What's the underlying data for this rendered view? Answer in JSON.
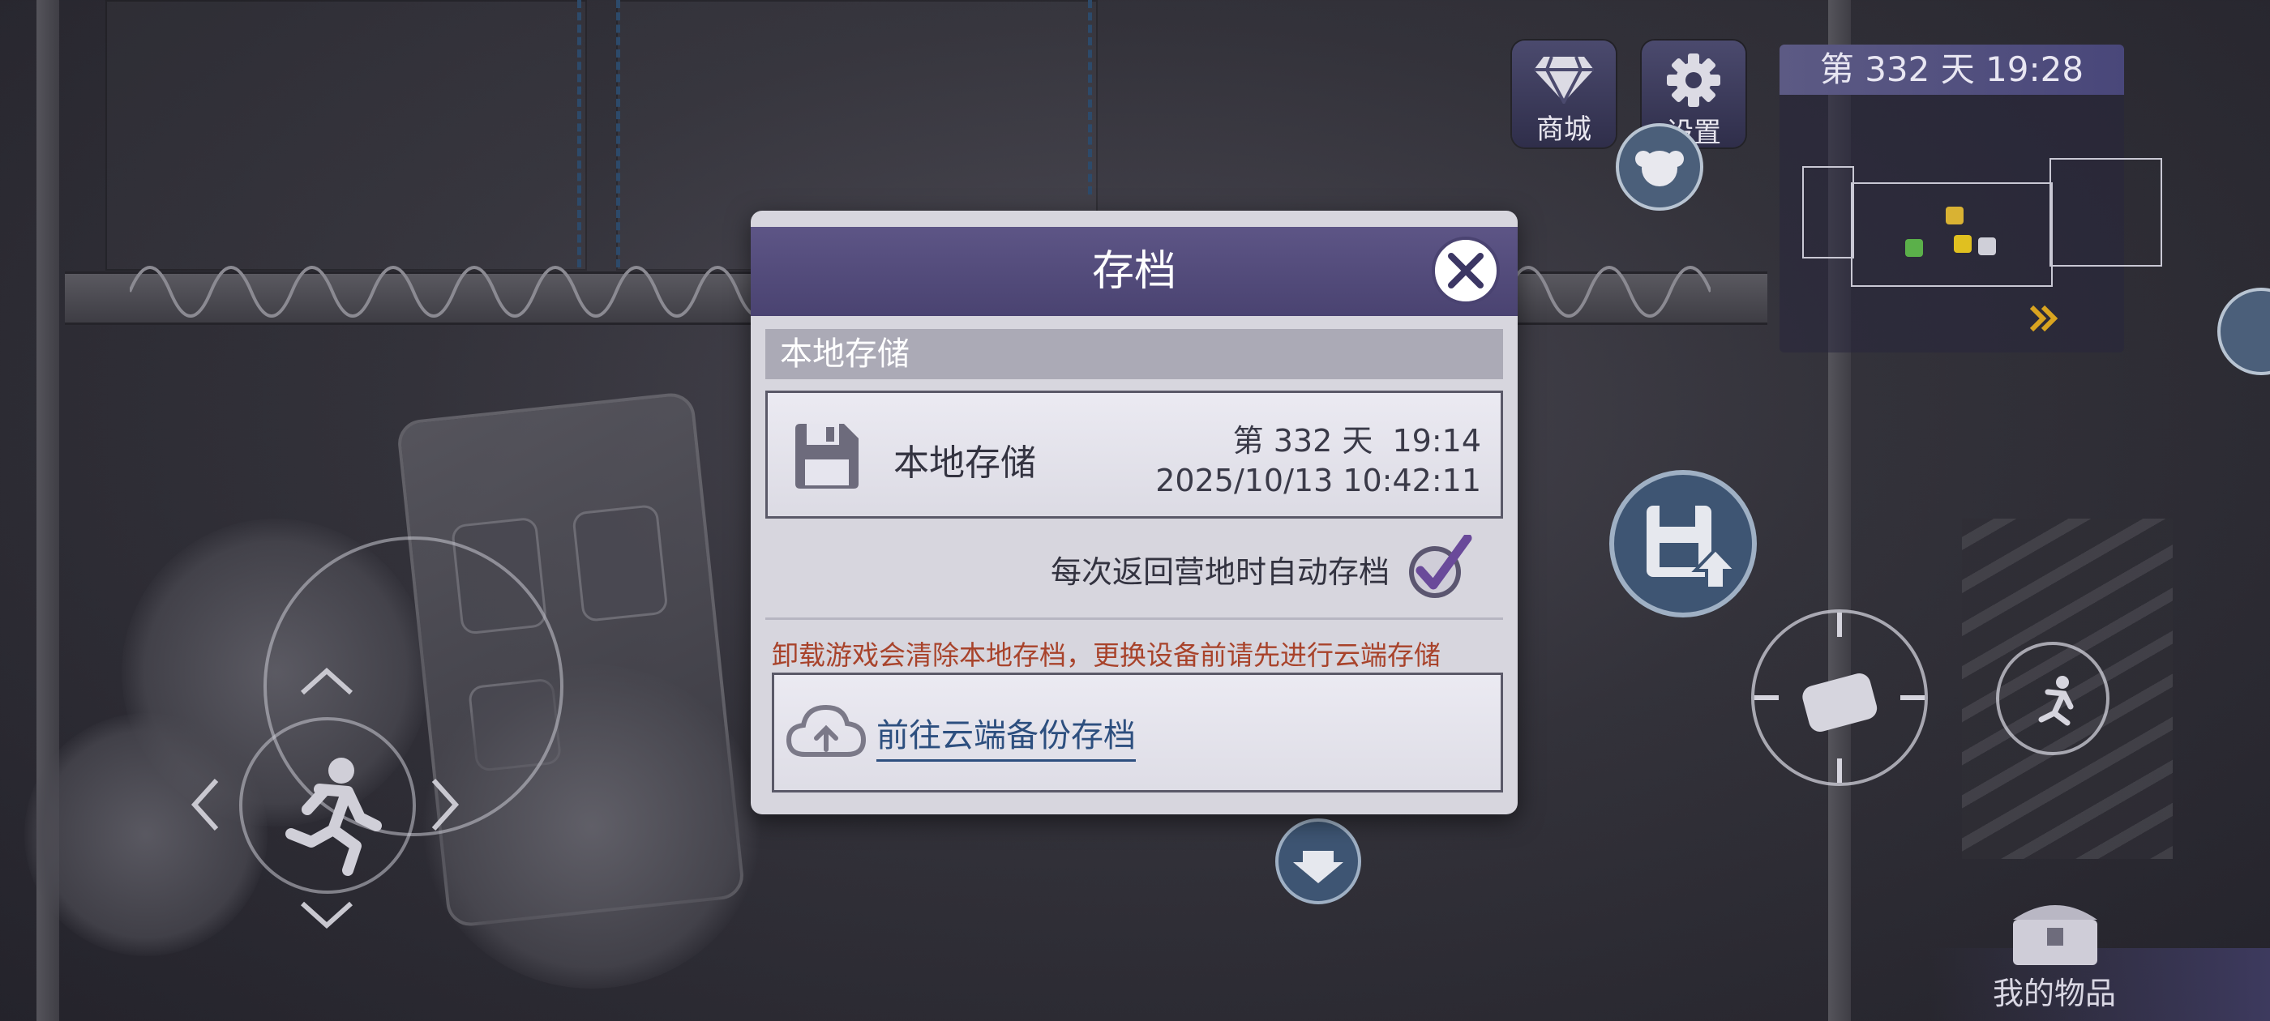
{
  "hud": {
    "shop_label": "商城",
    "settings_label": "设置",
    "day_time": "第 332 天  19:28",
    "inventory_label": "我的物品"
  },
  "dialog": {
    "title": "存档",
    "section_title": "本地存储",
    "slot": {
      "name": "本地存储",
      "day_time": "第 332 天  19:14",
      "datetime": "2025/10/13 10:42:11"
    },
    "autosave_label": "每次返回营地时自动存档",
    "autosave_checked": true,
    "warning": "卸载游戏会清除本地存档，更换设备前请先进行云端存储",
    "cloud_link": "前往云端备份存档"
  },
  "colors": {
    "dialog_header": "#4a4371",
    "warning_text": "#a8432b",
    "link_text": "#2d4f7f"
  }
}
